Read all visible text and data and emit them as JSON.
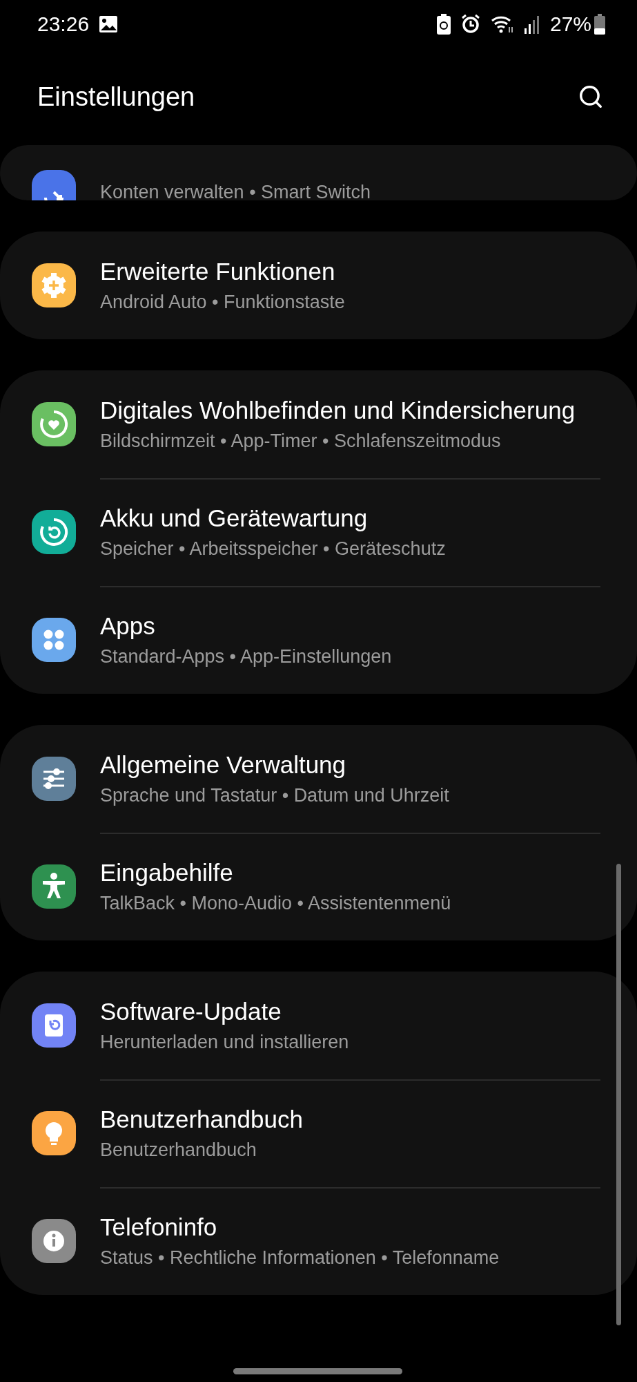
{
  "status_bar": {
    "time": "23:26",
    "battery": "27%"
  },
  "header": {
    "title": "Einstellungen"
  },
  "partial_card": {
    "items": [
      {
        "kind": "accounts",
        "color": "#4a73e8",
        "subtitle": "Konten verwalten • Smart Switch"
      }
    ]
  },
  "cards": [
    {
      "items": [
        {
          "kind": "advanced",
          "color": "#fbb848",
          "title": "Erweiterte Funktionen",
          "subtitle": "Android Auto • Funktionstaste"
        }
      ]
    },
    {
      "items": [
        {
          "kind": "wellbeing",
          "color": "#6abf62",
          "title": "Digitales Wohlbefinden und Kindersicherung",
          "subtitle": "Bildschirmzeit • App-Timer • Schlafenszeitmodus"
        },
        {
          "kind": "care",
          "color": "#12ad98",
          "title": "Akku und Gerätewartung",
          "subtitle": "Speicher • Arbeitsspeicher • Geräteschutz"
        },
        {
          "kind": "apps",
          "color": "#6aa8ec",
          "title": "Apps",
          "subtitle": "Standard-Apps • App-Einstellungen"
        }
      ]
    },
    {
      "items": [
        {
          "kind": "general",
          "color": "#5f7f99",
          "title": "Allgemeine Verwaltung",
          "subtitle": "Sprache und Tastatur • Datum und Uhrzeit"
        },
        {
          "kind": "accessibility",
          "color": "#2e9150",
          "title": "Eingabehilfe",
          "subtitle": "TalkBack • Mono-Audio • Assistentenmenü"
        }
      ]
    },
    {
      "items": [
        {
          "kind": "update",
          "color": "#7283f5",
          "title": "Software-Update",
          "subtitle": "Herunterladen und installieren"
        },
        {
          "kind": "manual",
          "color": "#fba543",
          "title": "Benutzerhandbuch",
          "subtitle": "Benutzerhandbuch"
        },
        {
          "kind": "info",
          "color": "#8a8a8a",
          "title": "Telefoninfo",
          "subtitle": "Status • Rechtliche Informationen • Telefonname"
        }
      ]
    }
  ]
}
